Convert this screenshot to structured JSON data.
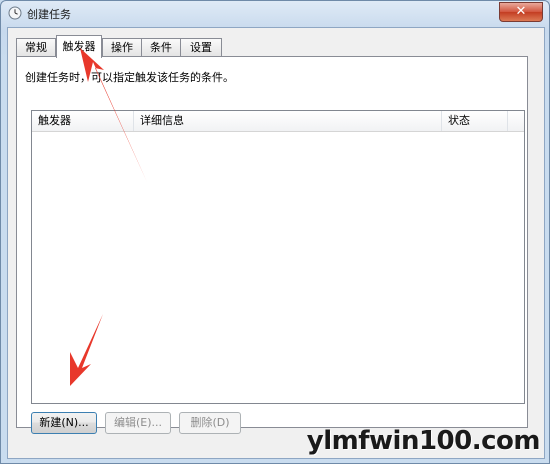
{
  "window": {
    "title": "创建任务",
    "close_symbol": "✕"
  },
  "tabs": [
    {
      "label": "常规"
    },
    {
      "label": "触发器",
      "active": true
    },
    {
      "label": "操作"
    },
    {
      "label": "条件"
    },
    {
      "label": "设置"
    }
  ],
  "panel": {
    "description": "创建任务时，可以指定触发该任务的条件。",
    "columns": [
      "触发器",
      "详细信息",
      "状态"
    ],
    "rows": []
  },
  "buttons": {
    "new": "新建(N)...",
    "edit": "编辑(E)...",
    "delete": "删除(D)"
  },
  "watermark": "ylmfwin100.com",
  "colors": {
    "annotation_arrow": "#e8382b",
    "accent": "#3c7fb1"
  }
}
